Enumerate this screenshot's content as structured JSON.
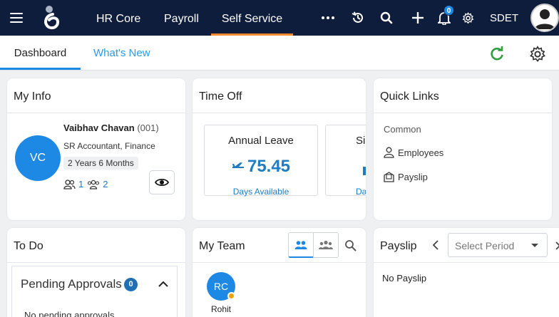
{
  "topbar": {
    "nav": [
      "HR Core",
      "Payroll",
      "Self Service"
    ],
    "active_nav": "Self Service",
    "notification_count": "0",
    "user_label": "SDET"
  },
  "tabs": {
    "dashboard": "Dashboard",
    "whats_new": "What's New"
  },
  "my_info": {
    "title": "My Info",
    "initials": "VC",
    "name": "Vaibhav Chavan",
    "code": "(001)",
    "designation": "SR Accountant, Finance",
    "tenure": "2 Years 6 Months",
    "direct_reports": "1",
    "team_count": "2"
  },
  "time_off": {
    "title": "Time Off",
    "leaves": [
      {
        "name": "Annual Leave",
        "value": "75.45",
        "sub": "Days Available"
      },
      {
        "name": "Si",
        "value": "",
        "sub": "Da"
      }
    ]
  },
  "quick_links": {
    "title": "Quick Links",
    "heading": "Common",
    "links": [
      "Employees",
      "Payslip"
    ]
  },
  "todo": {
    "title": "To Do",
    "pending_label": "Pending Approvals",
    "pending_count": "0",
    "empty_text": "No pending approvals"
  },
  "my_team": {
    "title": "My Team",
    "member_initials": "RC",
    "member_name": "Rohit"
  },
  "payslip": {
    "title": "Payslip",
    "select_placeholder": "Select Period",
    "empty_text": "No Payslip"
  },
  "colors": {
    "topbar_bg": "#0f1d3d",
    "accent_blue": "#1e88e5",
    "active_nav_underline": "#f08a2c",
    "refresh_green": "#2e9e3e"
  }
}
